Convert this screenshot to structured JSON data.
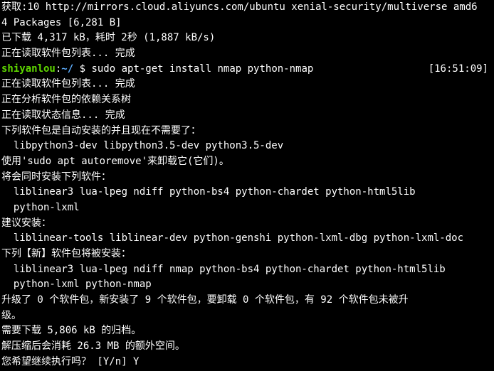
{
  "colors": {
    "background": "#000000",
    "text": "#ffffff",
    "prompt_user": "#5fd700",
    "prompt_path": "#5fafff"
  },
  "prompt": {
    "user": "shiyanlou",
    "colon": ":",
    "path": "~/",
    "symbol": " $ ",
    "command": "sudo apt-get install nmap python-nmap",
    "time": "[16:51:09]"
  },
  "lines_before": [
    "获取:10 http://mirrors.cloud.aliyuncs.com/ubuntu xenial-security/multiverse amd6",
    "4 Packages [6,281 B]",
    "已下载 4,317 kB，耗时 2秒 (1,887 kB/s)",
    "正在读取软件包列表... 完成"
  ],
  "lines_after": [
    "正在读取软件包列表... 完成",
    "正在分析软件包的依赖关系树",
    "正在读取状态信息... 完成",
    "下列软件包是自动安装的并且现在不需要了：",
    "  libpython3-dev libpython3.5-dev python3.5-dev",
    "使用'sudo apt autoremove'来卸载它(它们)。",
    "将会同时安装下列软件：",
    "  liblinear3 lua-lpeg ndiff python-bs4 python-chardet python-html5lib",
    "  python-lxml",
    "建议安装：",
    "  liblinear-tools liblinear-dev python-genshi python-lxml-dbg python-lxml-doc",
    "下列【新】软件包将被安装：",
    "  liblinear3 lua-lpeg ndiff nmap python-bs4 python-chardet python-html5lib",
    "  python-lxml python-nmap",
    "升级了 0 个软件包，新安装了 9 个软件包，要卸载 0 个软件包，有 92 个软件包未被升",
    "级。",
    "需要下载 5,806 kB 的归档。",
    "解压缩后会消耗 26.3 MB 的额外空间。",
    "您希望继续执行吗？ [Y/n] Y"
  ]
}
